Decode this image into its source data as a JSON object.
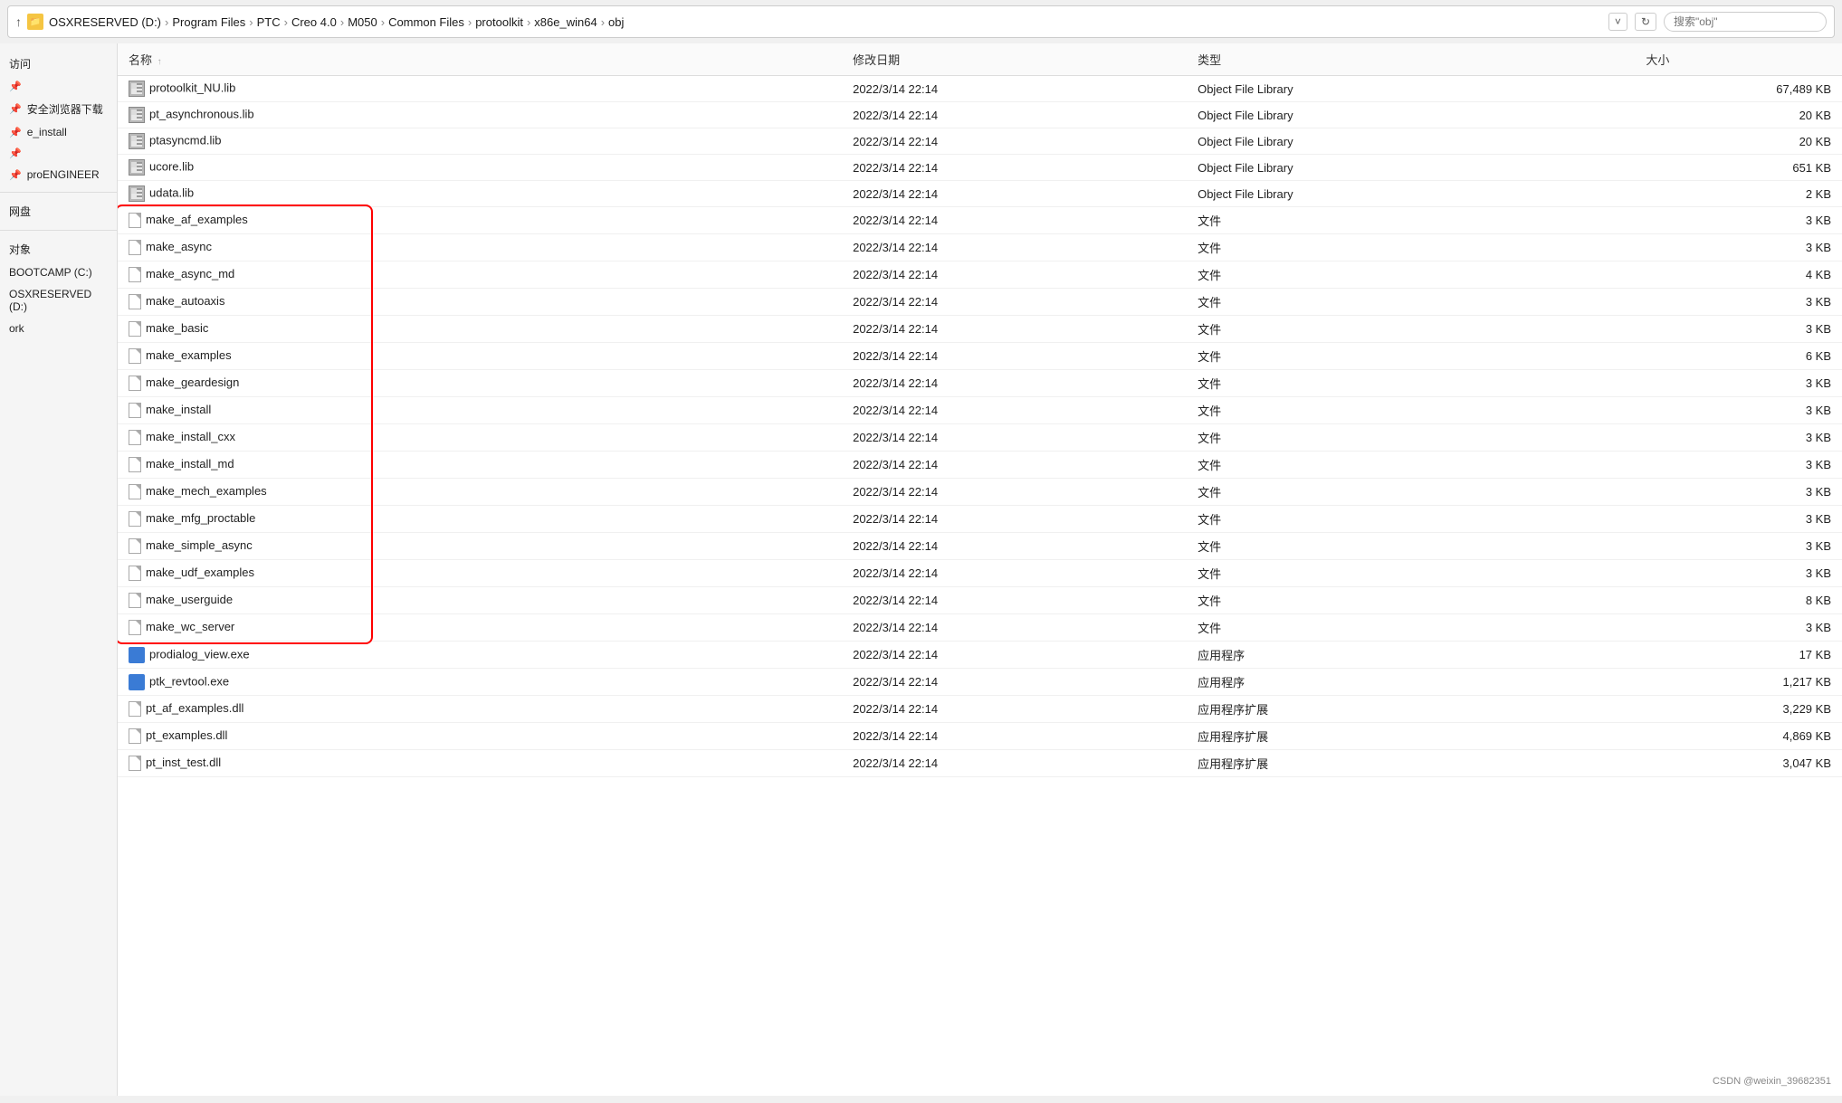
{
  "addressBar": {
    "upArrow": "↑",
    "folderIcon": "📁",
    "path": [
      "OSXRESERVED (D:)",
      "Program Files",
      "PTC",
      "Creo 4.0",
      "M050",
      "Common Files",
      "protoolkit",
      "x86e_win64",
      "obj"
    ],
    "separators": [
      "›",
      "›",
      "›",
      "›",
      "›",
      "›",
      "›",
      "›"
    ],
    "downButtonLabel": "˅",
    "refreshButtonLabel": "↻",
    "searchPlaceholder": "搜索\"obj\""
  },
  "sidebar": {
    "items": [
      {
        "label": "访问",
        "pin": false
      },
      {
        "label": "",
        "pin": true
      },
      {
        "label": "安全浏览器下载",
        "pin": true
      },
      {
        "label": "e_install",
        "pin": true
      },
      {
        "label": "",
        "pin": true
      },
      {
        "label": "proENGINEER",
        "pin": true
      },
      {
        "label": "",
        "pin": false
      },
      {
        "label": "网盘",
        "pin": false
      },
      {
        "label": "",
        "pin": false
      },
      {
        "label": "对象",
        "pin": false
      },
      {
        "label": "BOOTCAMP (C:)",
        "pin": false
      },
      {
        "label": "OSXRESERVED (D:)",
        "pin": false
      },
      {
        "label": "ork",
        "pin": false
      }
    ]
  },
  "table": {
    "columns": [
      {
        "label": "名称",
        "sortArrow": "↑"
      },
      {
        "label": "修改日期"
      },
      {
        "label": "类型"
      },
      {
        "label": "大小"
      }
    ],
    "rows": [
      {
        "icon": "lib",
        "name": "protoolkit_NU.lib",
        "date": "2022/3/14 22:14",
        "type": "Object File Library",
        "size": "67,489 KB"
      },
      {
        "icon": "lib",
        "name": "pt_asynchronous.lib",
        "date": "2022/3/14 22:14",
        "type": "Object File Library",
        "size": "20 KB"
      },
      {
        "icon": "lib",
        "name": "ptasyncmd.lib",
        "date": "2022/3/14 22:14",
        "type": "Object File Library",
        "size": "20 KB"
      },
      {
        "icon": "lib",
        "name": "ucore.lib",
        "date": "2022/3/14 22:14",
        "type": "Object File Library",
        "size": "651 KB"
      },
      {
        "icon": "lib",
        "name": "udata.lib",
        "date": "2022/3/14 22:14",
        "type": "Object File Library",
        "size": "2 KB"
      },
      {
        "icon": "file",
        "name": "make_af_examples",
        "date": "2022/3/14 22:14",
        "type": "文件",
        "size": "3 KB",
        "annotated": true
      },
      {
        "icon": "file",
        "name": "make_async",
        "date": "2022/3/14 22:14",
        "type": "文件",
        "size": "3 KB",
        "annotated": true
      },
      {
        "icon": "file",
        "name": "make_async_md",
        "date": "2022/3/14 22:14",
        "type": "文件",
        "size": "4 KB",
        "annotated": true
      },
      {
        "icon": "file",
        "name": "make_autoaxis",
        "date": "2022/3/14 22:14",
        "type": "文件",
        "size": "3 KB",
        "annotated": true
      },
      {
        "icon": "file",
        "name": "make_basic",
        "date": "2022/3/14 22:14",
        "type": "文件",
        "size": "3 KB",
        "annotated": true
      },
      {
        "icon": "file",
        "name": "make_examples",
        "date": "2022/3/14 22:14",
        "type": "文件",
        "size": "6 KB",
        "annotated": true
      },
      {
        "icon": "file",
        "name": "make_geardesign",
        "date": "2022/3/14 22:14",
        "type": "文件",
        "size": "3 KB",
        "annotated": true
      },
      {
        "icon": "file",
        "name": "make_install",
        "date": "2022/3/14 22:14",
        "type": "文件",
        "size": "3 KB",
        "annotated": true
      },
      {
        "icon": "file",
        "name": "make_install_cxx",
        "date": "2022/3/14 22:14",
        "type": "文件",
        "size": "3 KB",
        "annotated": true
      },
      {
        "icon": "file",
        "name": "make_install_md",
        "date": "2022/3/14 22:14",
        "type": "文件",
        "size": "3 KB",
        "annotated": true
      },
      {
        "icon": "file",
        "name": "make_mech_examples",
        "date": "2022/3/14 22:14",
        "type": "文件",
        "size": "3 KB",
        "annotated": true
      },
      {
        "icon": "file",
        "name": "make_mfg_proctable",
        "date": "2022/3/14 22:14",
        "type": "文件",
        "size": "3 KB",
        "annotated": true
      },
      {
        "icon": "file",
        "name": "make_simple_async",
        "date": "2022/3/14 22:14",
        "type": "文件",
        "size": "3 KB",
        "annotated": true
      },
      {
        "icon": "file",
        "name": "make_udf_examples",
        "date": "2022/3/14 22:14",
        "type": "文件",
        "size": "3 KB",
        "annotated": true
      },
      {
        "icon": "file",
        "name": "make_userguide",
        "date": "2022/3/14 22:14",
        "type": "文件",
        "size": "8 KB",
        "annotated": true
      },
      {
        "icon": "file",
        "name": "make_wc_server",
        "date": "2022/3/14 22:14",
        "type": "文件",
        "size": "3 KB",
        "annotated": true
      },
      {
        "icon": "exe",
        "name": "prodialog_view.exe",
        "date": "2022/3/14 22:14",
        "type": "应用程序",
        "size": "17 KB"
      },
      {
        "icon": "exe",
        "name": "ptk_revtool.exe",
        "date": "2022/3/14 22:14",
        "type": "应用程序",
        "size": "1,217 KB"
      },
      {
        "icon": "dll",
        "name": "pt_af_examples.dll",
        "date": "2022/3/14 22:14",
        "type": "应用程序扩展",
        "size": "3,229 KB"
      },
      {
        "icon": "dll",
        "name": "pt_examples.dll",
        "date": "2022/3/14 22:14",
        "type": "应用程序扩展",
        "size": "4,869 KB"
      },
      {
        "icon": "dll",
        "name": "pt_inst_test.dll",
        "date": "2022/3/14 22:14",
        "type": "应用程序扩展",
        "size": "3,047 KB"
      }
    ]
  },
  "watermark": "CSDN @weixin_39682351",
  "annotation": {
    "redBoxRows": "make_af_examples to make_wc_server"
  }
}
